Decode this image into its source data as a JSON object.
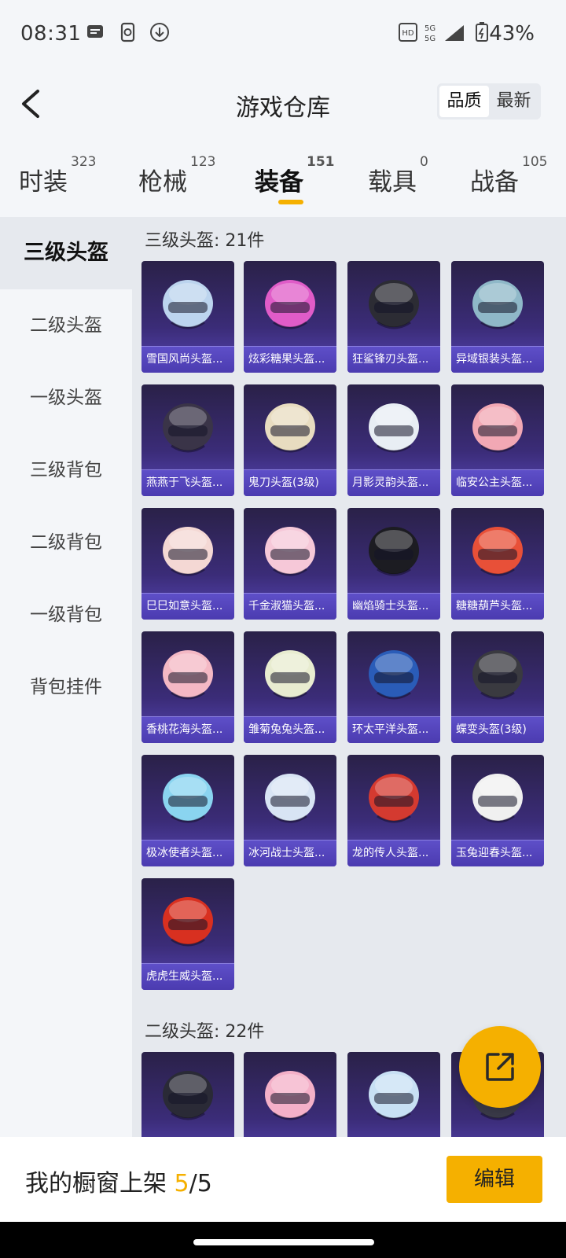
{
  "status": {
    "time": "08:31",
    "battery": "43%"
  },
  "header": {
    "title": "游戏仓库",
    "sort_quality": "品质",
    "sort_latest": "最新"
  },
  "tabs": [
    {
      "label": "时装",
      "count": "323"
    },
    {
      "label": "枪械",
      "count": "123"
    },
    {
      "label": "装备",
      "count": "151"
    },
    {
      "label": "载具",
      "count": "0"
    },
    {
      "label": "战备",
      "count": "105"
    }
  ],
  "sidebar": {
    "items": [
      "三级头盔",
      "二级头盔",
      "一级头盔",
      "三级背包",
      "二级背包",
      "一级背包",
      "背包挂件"
    ]
  },
  "sections": [
    {
      "title": "三级头盔: 21件",
      "items": [
        {
          "name": "雪国风尚头盔...",
          "color": "#bcd4ee"
        },
        {
          "name": "炫彩糖果头盔...",
          "color": "#e05cc8"
        },
        {
          "name": "狂鲨锋刃头盔...",
          "color": "#2c2c34"
        },
        {
          "name": "异域银装头盔...",
          "color": "#8fb8c8"
        },
        {
          "name": "燕燕于飞头盔...",
          "color": "#3a3448"
        },
        {
          "name": "鬼刀头盔(3级)",
          "color": "#e8dcc0"
        },
        {
          "name": "月影灵韵头盔...",
          "color": "#e8eef4"
        },
        {
          "name": "临安公主头盔...",
          "color": "#f2a8b4"
        },
        {
          "name": "巳巳如意头盔...",
          "color": "#f4d8d4"
        },
        {
          "name": "千金淑猫头盔...",
          "color": "#f6c8d8"
        },
        {
          "name": "幽焰骑士头盔...",
          "color": "#1c1c22"
        },
        {
          "name": "糖糖葫芦头盔...",
          "color": "#e85038"
        },
        {
          "name": "香桃花海头盔...",
          "color": "#f4b8c4"
        },
        {
          "name": "雏菊兔兔头盔...",
          "color": "#e8ecd0"
        },
        {
          "name": "环太平洋头盔...",
          "color": "#2a5cb8"
        },
        {
          "name": "蝶变头盔(3级)",
          "color": "#3a3a40"
        },
        {
          "name": "极冰使者头盔...",
          "color": "#8ad4f0"
        },
        {
          "name": "冰河战士头盔...",
          "color": "#d8e4f4"
        },
        {
          "name": "龙的传人头盔...",
          "color": "#d43a30"
        },
        {
          "name": "玉兔迎春头盔...",
          "color": "#f0f0f0"
        },
        {
          "name": "虎虎生威头盔...",
          "color": "#d83020"
        }
      ]
    },
    {
      "title": "二级头盔: 22件",
      "items": [
        {
          "name": "",
          "color": "#2a2a36"
        },
        {
          "name": "",
          "color": "#f4b0c8"
        },
        {
          "name": "",
          "color": "#c8e0f4"
        },
        {
          "name": "",
          "color": "#3a3a48"
        }
      ]
    }
  ],
  "bottom": {
    "showcase_label": "我的橱窗上架",
    "current": "5",
    "total": "/5",
    "edit": "编辑"
  },
  "icons": {
    "back": "chevron-left-icon",
    "fab": "share-external-icon"
  },
  "colors": {
    "accent": "#f5b000"
  }
}
